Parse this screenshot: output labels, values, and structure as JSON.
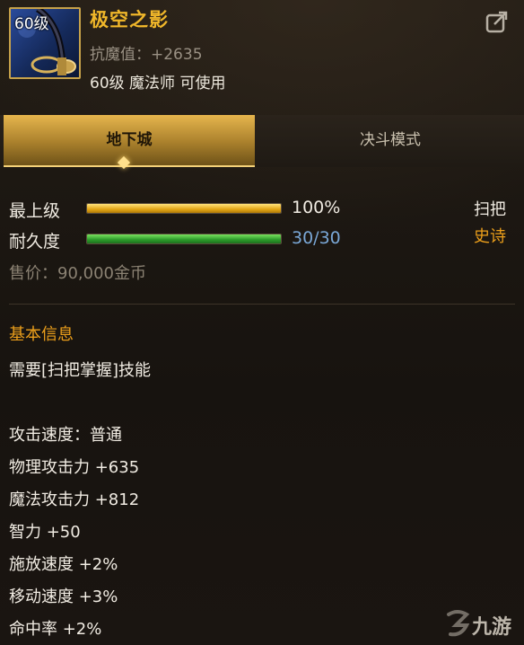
{
  "item": {
    "level_badge": "60级",
    "name": "极空之影",
    "resist": "抗魔值：+2635",
    "requirement": "60级 魔法师 可使用"
  },
  "tabs": [
    {
      "label": "地下城",
      "active": true
    },
    {
      "label": "决斗模式",
      "active": false
    }
  ],
  "bars": {
    "grade_label": "最上级",
    "grade_value": "100%",
    "grade_fraction": 1.0,
    "durability_label": "耐久度",
    "durability_value": "30/30",
    "durability_fraction": 1.0
  },
  "type": {
    "weapon_type": "扫把",
    "rarity": "史诗"
  },
  "price": "售价：90,000金币",
  "basic_info": {
    "title": "基本信息",
    "skill_requirement": "需要[扫把掌握]技能"
  },
  "stats": [
    "攻击速度：普通",
    "物理攻击力 +635",
    "魔法攻击力 +812",
    "智力 +50",
    "施放速度 +2%",
    "移动速度 +3%",
    "命中率 +2%"
  ],
  "watermark": "九游",
  "colors": {
    "name_gold": "#f0b72a",
    "rarity_orange": "#ec9f1b",
    "durability_blue": "#7aa7d6"
  }
}
